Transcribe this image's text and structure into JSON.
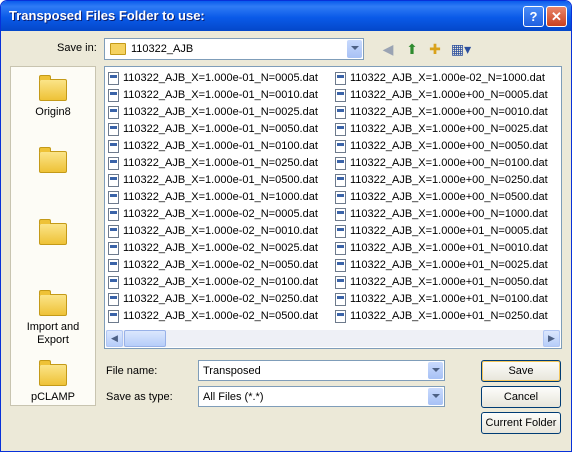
{
  "window": {
    "title": "Transposed Files Folder to use:"
  },
  "titlebar": {
    "help": "?",
    "close": "✕"
  },
  "save_in": {
    "label": "Save in:",
    "value": "110322_AJB"
  },
  "places": [
    {
      "label": "Origin8"
    },
    {
      "label": ""
    },
    {
      "label": ""
    },
    {
      "label": "Import and Export"
    },
    {
      "label": "pCLAMP"
    }
  ],
  "files_col1": [
    "110322_AJB_X=1.000e-01_N=0005.dat",
    "110322_AJB_X=1.000e-01_N=0010.dat",
    "110322_AJB_X=1.000e-01_N=0025.dat",
    "110322_AJB_X=1.000e-01_N=0050.dat",
    "110322_AJB_X=1.000e-01_N=0100.dat",
    "110322_AJB_X=1.000e-01_N=0250.dat",
    "110322_AJB_X=1.000e-01_N=0500.dat",
    "110322_AJB_X=1.000e-01_N=1000.dat",
    "110322_AJB_X=1.000e-02_N=0005.dat",
    "110322_AJB_X=1.000e-02_N=0010.dat",
    "110322_AJB_X=1.000e-02_N=0025.dat",
    "110322_AJB_X=1.000e-02_N=0050.dat",
    "110322_AJB_X=1.000e-02_N=0100.dat",
    "110322_AJB_X=1.000e-02_N=0250.dat",
    "110322_AJB_X=1.000e-02_N=0500.dat"
  ],
  "files_col2": [
    "110322_AJB_X=1.000e-02_N=1000.dat",
    "110322_AJB_X=1.000e+00_N=0005.dat",
    "110322_AJB_X=1.000e+00_N=0010.dat",
    "110322_AJB_X=1.000e+00_N=0025.dat",
    "110322_AJB_X=1.000e+00_N=0050.dat",
    "110322_AJB_X=1.000e+00_N=0100.dat",
    "110322_AJB_X=1.000e+00_N=0250.dat",
    "110322_AJB_X=1.000e+00_N=0500.dat",
    "110322_AJB_X=1.000e+00_N=1000.dat",
    "110322_AJB_X=1.000e+01_N=0005.dat",
    "110322_AJB_X=1.000e+01_N=0010.dat",
    "110322_AJB_X=1.000e+01_N=0025.dat",
    "110322_AJB_X=1.000e+01_N=0050.dat",
    "110322_AJB_X=1.000e+01_N=0100.dat",
    "110322_AJB_X=1.000e+01_N=0250.dat"
  ],
  "file_name": {
    "label": "File name:",
    "value": "Transposed"
  },
  "save_as_type": {
    "label": "Save as type:",
    "value": "All Files (*.*)"
  },
  "buttons": {
    "save": "Save",
    "cancel": "Cancel",
    "current_folder": "Current Folder"
  },
  "toolbar_icons": [
    "back-icon",
    "up-folder-icon",
    "new-folder-icon",
    "view-menu-icon"
  ]
}
